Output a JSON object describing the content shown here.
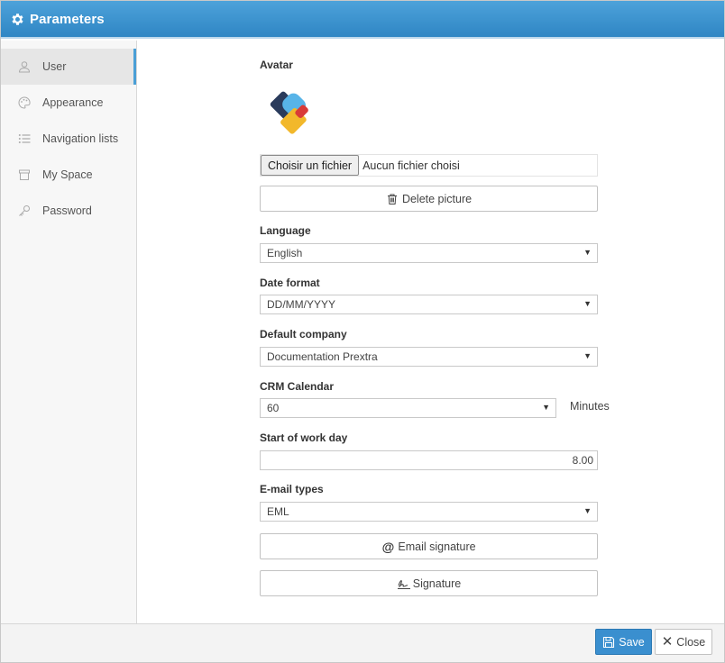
{
  "window": {
    "title": "Parameters",
    "title_icon": "gear-icon"
  },
  "sidebar": {
    "items": [
      {
        "label": "User",
        "icon": "user-icon",
        "active": true
      },
      {
        "label": "Appearance",
        "icon": "palette-icon",
        "active": false
      },
      {
        "label": "Navigation lists",
        "icon": "list-icon",
        "active": false
      },
      {
        "label": "My Space",
        "icon": "archive-icon",
        "active": false
      },
      {
        "label": "Password",
        "icon": "key-icon",
        "active": false
      }
    ]
  },
  "form": {
    "avatar_label": "Avatar",
    "file_button_label": "Choisir un fichier",
    "file_status": "Aucun fichier choisi",
    "delete_picture_label": "Delete picture",
    "language": {
      "label": "Language",
      "value": "English"
    },
    "date_format": {
      "label": "Date format",
      "value": "DD/MM/YYYY"
    },
    "default_company": {
      "label": "Default company",
      "value": "Documentation Prextra"
    },
    "crm_calendar": {
      "label": "CRM Calendar",
      "value": "60",
      "unit": "Minutes"
    },
    "start_of_work_day": {
      "label": "Start of work day",
      "value": "8.00"
    },
    "email_types": {
      "label": "E-mail types",
      "value": "EML"
    },
    "email_signature_label": "Email signature",
    "signature_label": "Signature"
  },
  "footer": {
    "save_label": "Save",
    "close_label": "Close"
  },
  "colors": {
    "accent": "#3a8fcf",
    "titlebar": "#3a92cf"
  }
}
